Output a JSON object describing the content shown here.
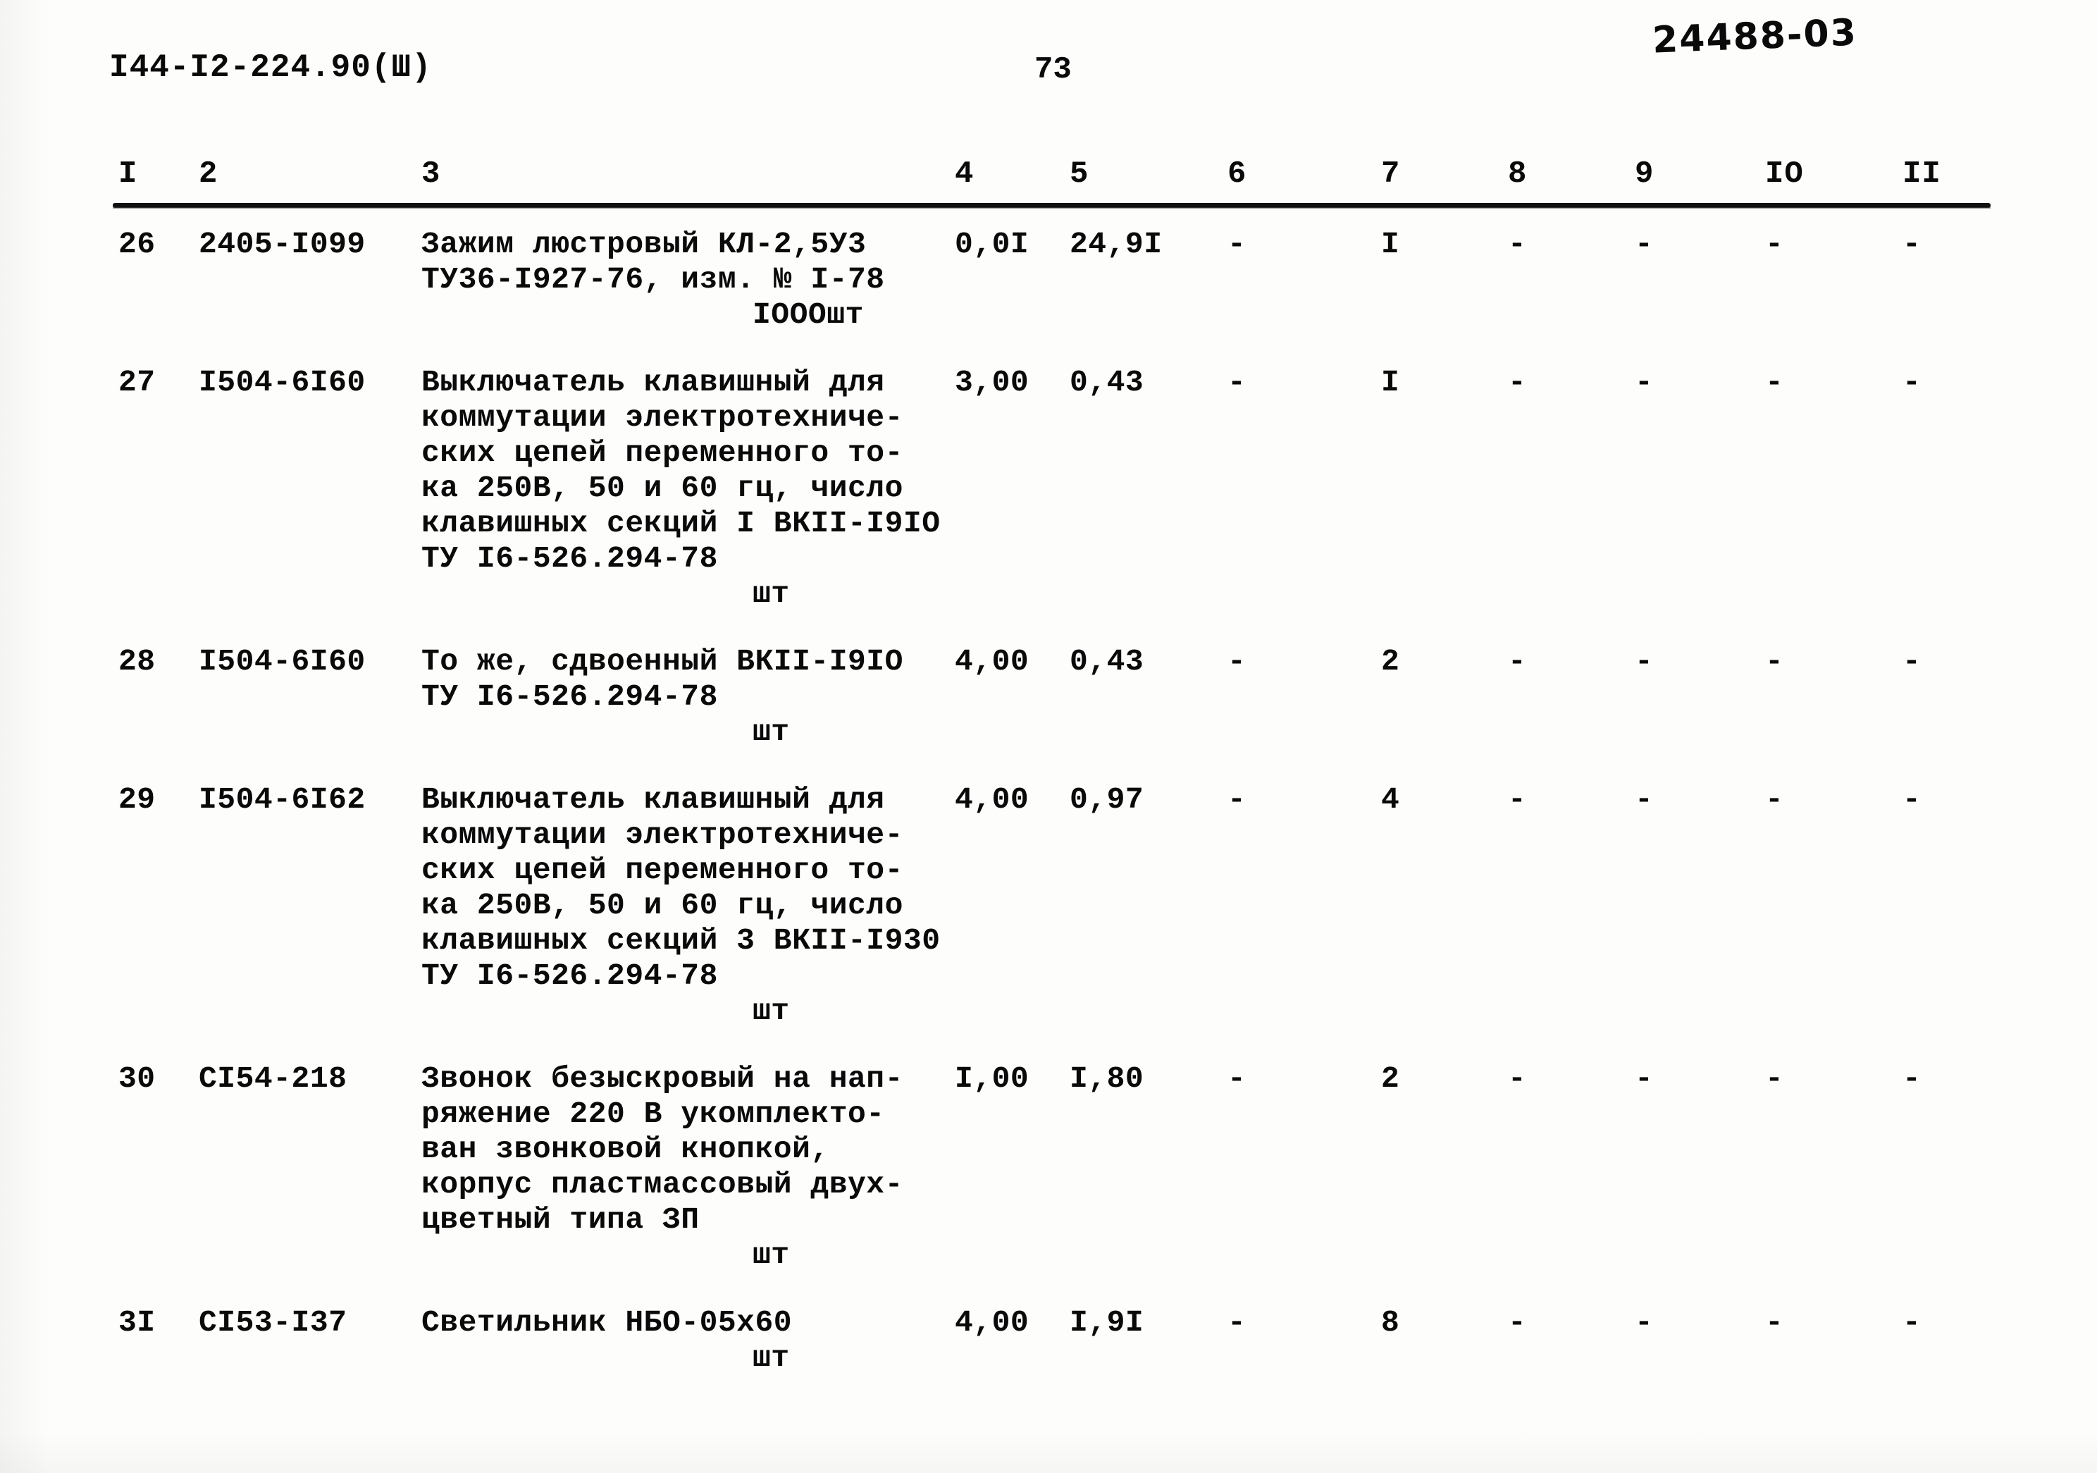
{
  "header": {
    "doc_code": "I44-I2-224.90(Ш)",
    "page_number": "73",
    "archive_stamp": "24488-03"
  },
  "table": {
    "column_headers": [
      "I",
      "2",
      "3",
      "4",
      "5",
      "6",
      "7",
      "8",
      "9",
      "IO",
      "II"
    ],
    "rows": [
      {
        "num": "26",
        "code": "2405-I099",
        "description": "Зажим люстровый КЛ-2,5У3\nТУ36-I927-76, изм. № I-78",
        "unit": "IOOOшт",
        "c4": "0,0I",
        "c5": "24,9I",
        "c6": "-",
        "c7": "I",
        "c8": "-",
        "c9": "-",
        "c10": "-",
        "c11": "-"
      },
      {
        "num": "27",
        "code": "I504-6I60",
        "description": "Выключатель клавишный для\nкоммутации электротехниче-\nских цепей переменного то-\nка 250В, 50 и 60 гц, число\nклавишных секций I ВКII-I9IO\nТУ I6-526.294-78",
        "unit": "шт",
        "c4": "3,00",
        "c5": "0,43",
        "c6": "-",
        "c7": "I",
        "c8": "-",
        "c9": "-",
        "c10": "-",
        "c11": "-"
      },
      {
        "num": "28",
        "code": "I504-6I60",
        "description": "То же, сдвоенный ВКII-I9IO\nТУ I6-526.294-78",
        "unit": "шт",
        "c4": "4,00",
        "c5": "0,43",
        "c6": "-",
        "c7": "2",
        "c8": "-",
        "c9": "-",
        "c10": "-",
        "c11": "-"
      },
      {
        "num": "29",
        "code": "I504-6I62",
        "description": "Выключатель клавишный для\nкоммутации электротехниче-\nских цепей переменного то-\nка 250В, 50 и 60 гц, число\nклавишных секций 3 ВКII-I930\nТУ I6-526.294-78",
        "unit": "шт",
        "c4": "4,00",
        "c5": "0,97",
        "c6": "-",
        "c7": "4",
        "c8": "-",
        "c9": "-",
        "c10": "-",
        "c11": "-"
      },
      {
        "num": "30",
        "code": "CI54-218",
        "description": "Звонок безыскровый на нап-\nряжение 220 В укомплекто-\nван звонковой кнопкой,\nкорпус пластмассовый двух-\nцветный типа ЗП",
        "unit": "шт",
        "c4": "I,00",
        "c5": "I,80",
        "c6": "-",
        "c7": "2",
        "c8": "-",
        "c9": "-",
        "c10": "-",
        "c11": "-"
      },
      {
        "num": "3I",
        "code": "CI53-I37",
        "description": "Светильник НБО-05х60",
        "unit": "шт",
        "c4": "4,00",
        "c5": "I,9I",
        "c6": "-",
        "c7": "8",
        "c8": "-",
        "c9": "-",
        "c10": "-",
        "c11": "-"
      }
    ]
  }
}
